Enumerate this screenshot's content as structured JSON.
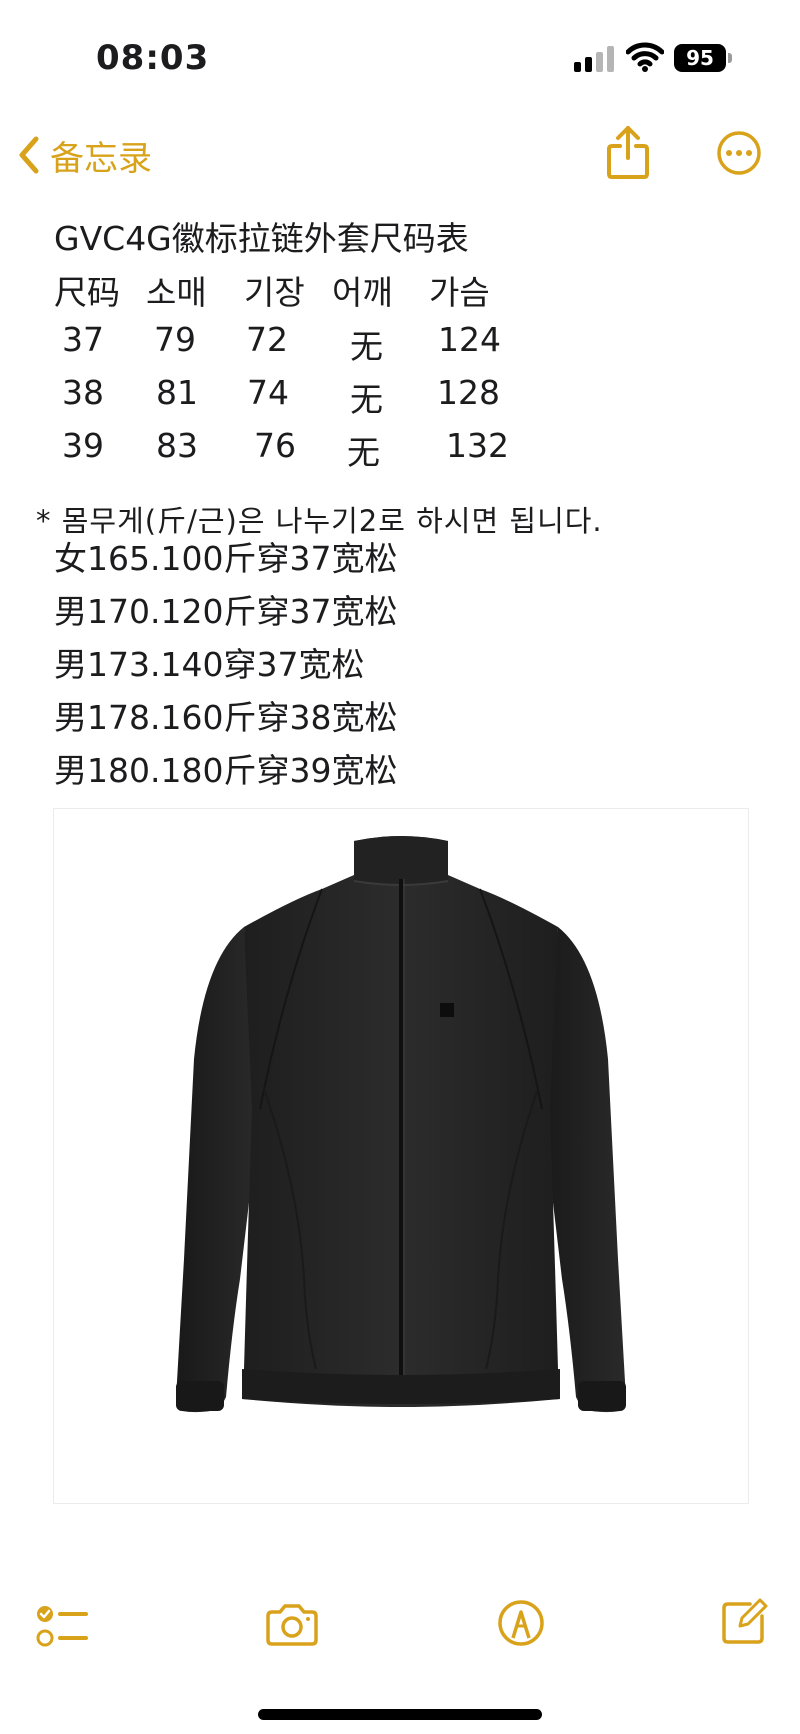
{
  "status_bar": {
    "time": "08:03",
    "battery_level": "95",
    "signal_bars_active": 2,
    "signal_bars_total": 4
  },
  "nav": {
    "back_label": "备忘录",
    "accent_color": "#d9a21b",
    "icons": [
      "chevron-left-icon",
      "share-icon",
      "more-icon"
    ]
  },
  "note": {
    "title": "GVC4G徽标拉链外套尺码表",
    "table_header": [
      "尺码",
      "소매",
      "기장",
      "어깨",
      "가슴"
    ],
    "table_rows": [
      [
        "37",
        "79",
        "72",
        "无",
        "124"
      ],
      [
        "38",
        "81",
        "74",
        "无",
        "128"
      ],
      [
        "39",
        "83",
        "76",
        "无",
        "132"
      ]
    ],
    "remark": "* 몸무게(斤/근)은 나누기2로 하시면 됩니다.",
    "guide_lines": [
      "女165.100斤穿37宽松",
      "男170.120斤穿37宽松",
      "男173.140穿37宽松",
      "男178.160斤穿38宽松",
      "男180.180斤穿39宽松"
    ]
  },
  "image": {
    "subject": "black-zip-jacket"
  },
  "toolbar": {
    "icons": [
      "checklist-icon",
      "camera-icon",
      "markup-icon",
      "compose-icon"
    ]
  }
}
